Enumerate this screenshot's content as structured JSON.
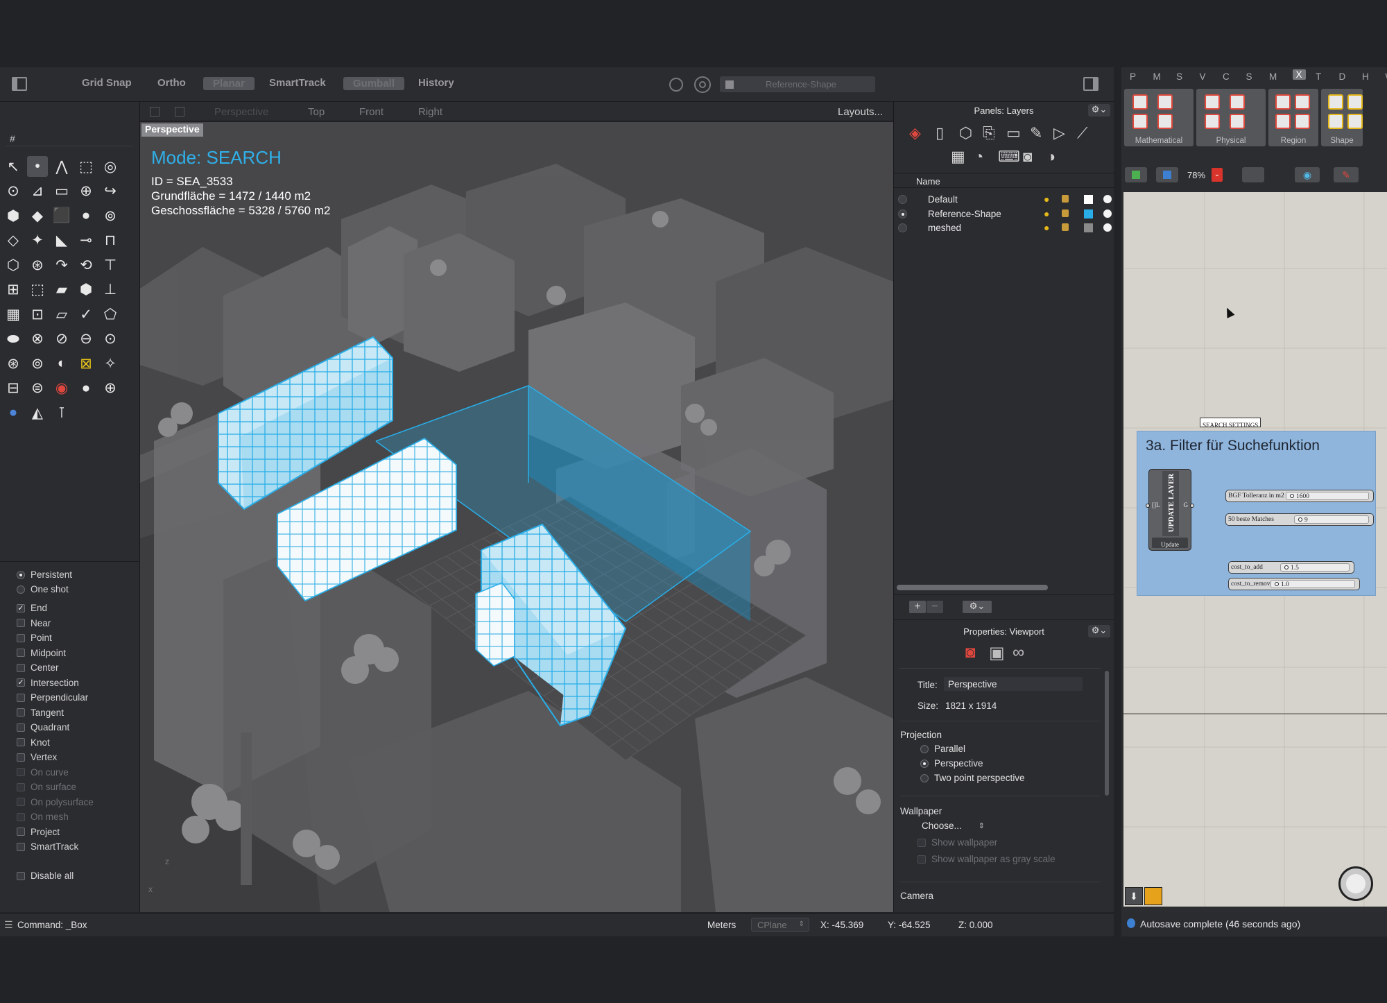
{
  "toolbar": {
    "grid_snap": "Grid Snap",
    "ortho": "Ortho",
    "planar": "Planar",
    "smarttrack": "SmartTrack",
    "gumball": "Gumball",
    "history": "History",
    "layer_field": "Reference-Shape"
  },
  "view_tabs": {
    "perspective": "Perspective",
    "top": "Top",
    "front": "Front",
    "right": "Right",
    "layouts": "Layouts..."
  },
  "command_search_text": "#",
  "viewport": {
    "label": "Perspective",
    "mode_text": "Mode: SEARCH",
    "id_text": "ID = SEA_3533",
    "grundflaeche_text": "Grundfläche = 1472 / 1440 m2",
    "geschossflaeche_text": "Geschossfläche = 5328 / 5760 m2"
  },
  "osnap": {
    "persistent": "Persistent",
    "one_shot": "One shot",
    "items": [
      {
        "label": "End",
        "checked": true,
        "enabled": true
      },
      {
        "label": "Near",
        "checked": false,
        "enabled": true
      },
      {
        "label": "Point",
        "checked": false,
        "enabled": true
      },
      {
        "label": "Midpoint",
        "checked": false,
        "enabled": true
      },
      {
        "label": "Center",
        "checked": false,
        "enabled": true
      },
      {
        "label": "Intersection",
        "checked": true,
        "enabled": true
      },
      {
        "label": "Perpendicular",
        "checked": false,
        "enabled": true
      },
      {
        "label": "Tangent",
        "checked": false,
        "enabled": true
      },
      {
        "label": "Quadrant",
        "checked": false,
        "enabled": true
      },
      {
        "label": "Knot",
        "checked": false,
        "enabled": true
      },
      {
        "label": "Vertex",
        "checked": false,
        "enabled": true
      },
      {
        "label": "On curve",
        "checked": false,
        "enabled": false
      },
      {
        "label": "On surface",
        "checked": false,
        "enabled": false
      },
      {
        "label": "On polysurface",
        "checked": false,
        "enabled": false
      },
      {
        "label": "On mesh",
        "checked": false,
        "enabled": false
      },
      {
        "label": "Project",
        "checked": false,
        "enabled": true
      },
      {
        "label": "SmartTrack",
        "checked": false,
        "enabled": true
      }
    ],
    "disable_all": "Disable all"
  },
  "layers_panel": {
    "title": "Panels: Layers",
    "column_name": "Name",
    "layers": [
      {
        "name": "Default",
        "color": "#ffffff"
      },
      {
        "name": "Reference-Shape",
        "color": "#29aee8"
      },
      {
        "name": "meshed",
        "color": "#8a8a8a"
      }
    ]
  },
  "properties_panel": {
    "title": "Properties: Viewport",
    "title_label": "Title:",
    "title_value": "Perspective",
    "size_label": "Size:",
    "size_value": "1821 x 1914",
    "projection_heading": "Projection",
    "projection_parallel": "Parallel",
    "projection_perspective": "Perspective",
    "projection_two_point": "Two point perspective",
    "wallpaper_heading": "Wallpaper",
    "wallpaper_choose": "Choose...",
    "show_wallpaper": "Show wallpaper",
    "show_wallpaper_gray": "Show wallpaper as gray scale",
    "camera_heading": "Camera"
  },
  "statusbar": {
    "command": "Command: _Box",
    "units": "Meters",
    "cplane": "CPlane",
    "x": "X: -45.369",
    "y": "Y: -64.525",
    "z": "Z: 0.000"
  },
  "grasshopper": {
    "tabs": [
      "P",
      "M",
      "S",
      "V",
      "C",
      "S",
      "M",
      "X",
      "T",
      "D",
      "H",
      "W"
    ],
    "active_tab": "X",
    "groups": [
      "Mathematical",
      "Physical",
      "Region",
      "Shape"
    ],
    "zoom": "78%",
    "group_tag": "SEARCH SETTINGS",
    "group_title": "3a. Filter für Suchefunktion",
    "component": {
      "title": "UPDATE LAYER",
      "input": "[]L",
      "output": "G",
      "button": "Update"
    },
    "sliders": [
      {
        "label": "BGF Tolleranz in m2",
        "value": "1600"
      },
      {
        "label": "50 beste Matches",
        "value": "9"
      },
      {
        "label": "cost_to_add",
        "value": "1.5"
      },
      {
        "label": "cost_to_remove",
        "value": "1.0"
      }
    ],
    "autosave": "Autosave complete (46 seconds ago)"
  },
  "colors": {
    "accent_blue": "#29aee8",
    "viewport_bg": "#444446",
    "gh_canvas": "#d6d3cc",
    "gh_group": "#8fb5dc"
  }
}
